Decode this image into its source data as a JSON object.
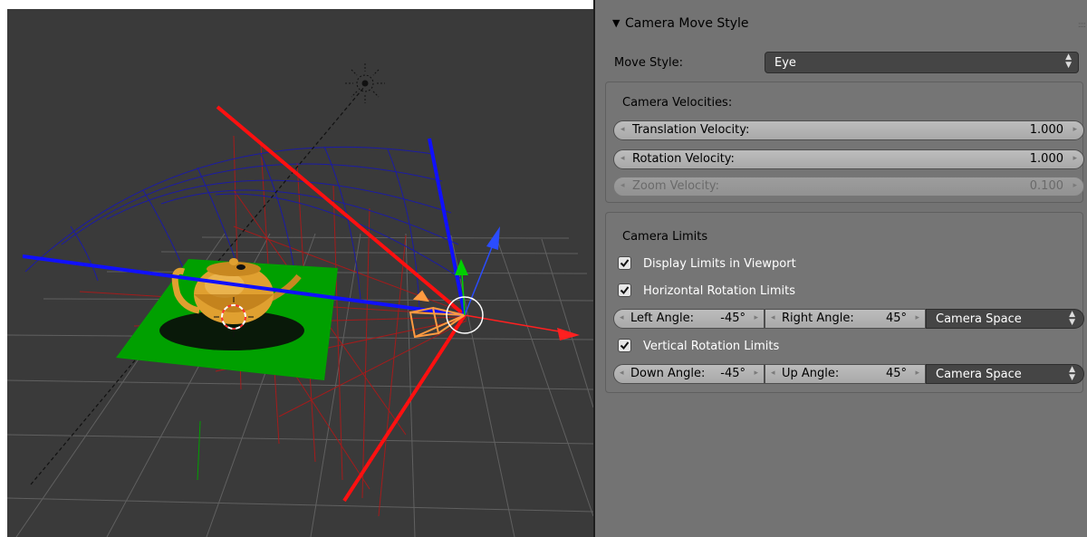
{
  "panel": {
    "title": "Camera Move Style",
    "move_style": {
      "label": "Move Style:",
      "value": "Eye"
    },
    "velocities": {
      "heading": "Camera Velocities:",
      "translation": {
        "label": "Translation Velocity:",
        "value": "1.000"
      },
      "rotation": {
        "label": "Rotation Velocity:",
        "value": "1.000"
      },
      "zoom": {
        "label": "Zoom Velocity:",
        "value": "0.100"
      }
    },
    "limits": {
      "heading": "Camera Limits",
      "display_limits": {
        "label": "Display Limits in Viewport",
        "checked": true
      },
      "horizontal": {
        "label": "Horizontal Rotation Limits",
        "checked": true,
        "left": {
          "label": "Left Angle:",
          "value": "-45°"
        },
        "right": {
          "label": "Right Angle:",
          "value": "45°"
        },
        "space": "Camera Space"
      },
      "vertical": {
        "label": "Vertical Rotation Limits",
        "checked": true,
        "down": {
          "label": "Down Angle:",
          "value": "-45°"
        },
        "up": {
          "label": "Up Angle:",
          "value": "45°"
        },
        "space": "Camera Space"
      }
    }
  },
  "colors": {
    "viewport_bg": "#3a3a3a",
    "panel_bg": "#737373",
    "x_axis": "#ff0000",
    "y_axis": "#00cc00",
    "z_axis": "#0000ff",
    "ground_plane": "#00a000",
    "teapot": "#e0a030"
  },
  "icons": {
    "collapse": "triangle-down-icon",
    "checkbox": "checkmark-icon",
    "dropdown": "updown-arrows-icon",
    "lamp": "sun-lamp-icon"
  }
}
